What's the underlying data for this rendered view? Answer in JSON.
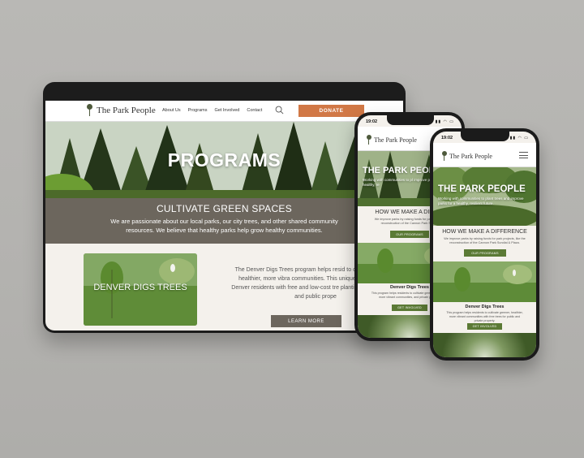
{
  "tablet": {
    "logo": "The Park People",
    "nav": [
      "About Us",
      "Programs",
      "Get Involved",
      "Contact"
    ],
    "donate_label": "DONATE",
    "hero_title": "PROGRAMS",
    "band_title": "CULTIVATE GREEN SPACES",
    "band_text": "We are passionate about our local parks, our city trees, and other shared community resources. We believe that healthy parks help grow healthy communities.",
    "card_title": "DENVER DIGS TREES",
    "program_text": "The Denver Digs Trees program helps resid to cultivate greener, healthier, more vibra communities.  This unique program provi Denver residents with free and low-cost tre planting on both private and public prope",
    "learn_more": "LEARN MORE"
  },
  "phone1": {
    "time": "19:02",
    "logo": "The Park People",
    "hero_title": "THE PARK PEOPL",
    "hero_sub": "Working with communities to pl improve parks for a healthy, re",
    "section_title": "HOW WE MAKE A DIFFER",
    "section_text": "We improve parks by raising funds for park projects reconstruction of the Cannon Park Sundat",
    "button": "OUR PROGRAMS",
    "card_title": "Denver Digs Trees",
    "card_text": "This program helps residents to cultivate greener, healthier, more vibrant communities, and private property.",
    "card_button": "GET INVOLVED"
  },
  "phone2": {
    "time": "19:02",
    "logo": "The Park People",
    "hero_title": "THE PARK PEOPLE",
    "hero_sub": "Working with communities to plant trees and improve parks for a healthy, resilient future.",
    "section_title": "HOW WE MAKE A DIFFERENCE",
    "section_text": "We improve parks by raising funds for park projects, like the reconstruction of the Cannon Park Sundial & Plaza.",
    "button": "OUR PROGRAMS",
    "card_title": "Denver Digs Trees",
    "card_text": "This program helps residents to cultivate greener, healthier, more vibrant communities with free trees for public and private property.",
    "card_button": "GET INVOLVED"
  }
}
